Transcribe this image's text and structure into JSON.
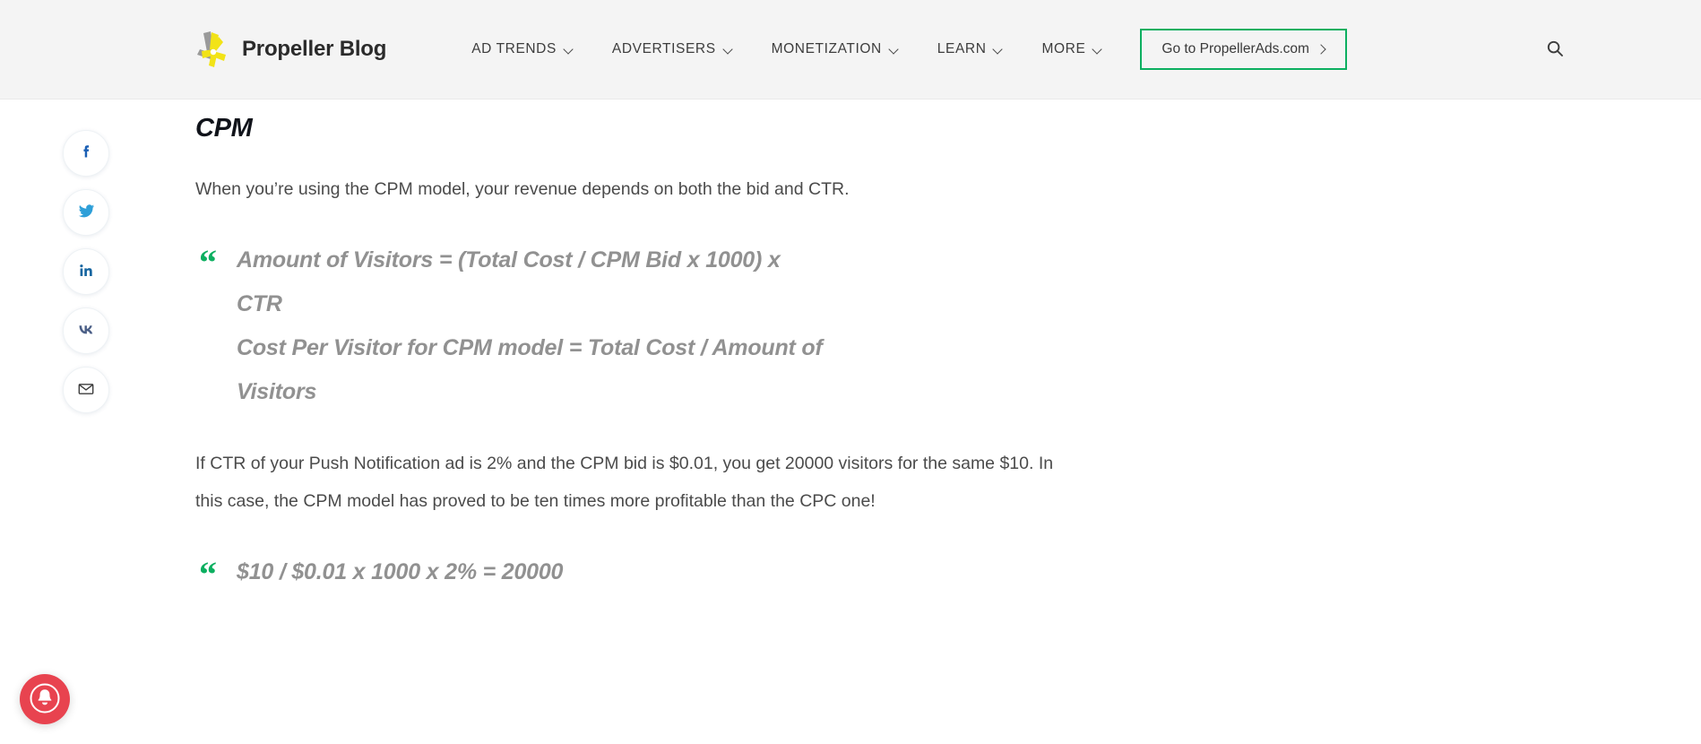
{
  "header": {
    "brand": {
      "title": "Propeller Blog",
      "logo_icon": "propeller-logo-icon"
    },
    "nav_items": [
      {
        "label": "AD TRENDS",
        "has_dropdown": true
      },
      {
        "label": "ADVERTISERS",
        "has_dropdown": true
      },
      {
        "label": "MONETIZATION",
        "has_dropdown": true
      },
      {
        "label": "LEARN",
        "has_dropdown": true
      },
      {
        "label": "MORE",
        "has_dropdown": true
      }
    ],
    "cta": {
      "label": "Go to PropellerAds.com",
      "icon": "chevron-right-icon",
      "border_color": "#0caf60"
    },
    "search": {
      "icon": "search-icon",
      "label": "Search"
    },
    "background_color": "#f4f4f4"
  },
  "share_rail": {
    "items": [
      {
        "name": "facebook",
        "label": "Share on Facebook",
        "color": "#1a5fb4"
      },
      {
        "name": "twitter",
        "label": "Share on Twitter",
        "color": "#2e9fd8"
      },
      {
        "name": "linkedin",
        "label": "Share on LinkedIn",
        "color": "#1565a0"
      },
      {
        "name": "vk",
        "label": "Share on VK",
        "color": "#4a5e86"
      },
      {
        "name": "email",
        "label": "Share by Email",
        "color": "#3c3c3c"
      }
    ]
  },
  "article": {
    "heading": "CPM",
    "paragraph_1": "When you’re using the CPM model, your revenue depends on both the bid and CTR.",
    "quote_1": {
      "mark": "“",
      "line_1": "Amount of Visitors = (Total Cost / CPM Bid x 1000) x",
      "line_2": "CTR",
      "line_3": "Cost Per Visitor for CPM model = Total Cost / Amount of",
      "line_4": "Visitors"
    },
    "paragraph_2": "If CTR of your Push Notification ad is 2% and the CPM bid is $0.01, you get 20000 visitors for the same $10. In this case, the CPM model has proved to be ten times more profitable than the CPC one!",
    "quote_2": {
      "mark": "“",
      "line_1": "$10 / $0.01 x 1000 x 2% = 20000"
    }
  },
  "notification": {
    "icon": "bell-icon",
    "label": "Notifications",
    "color": "#e8434f"
  }
}
